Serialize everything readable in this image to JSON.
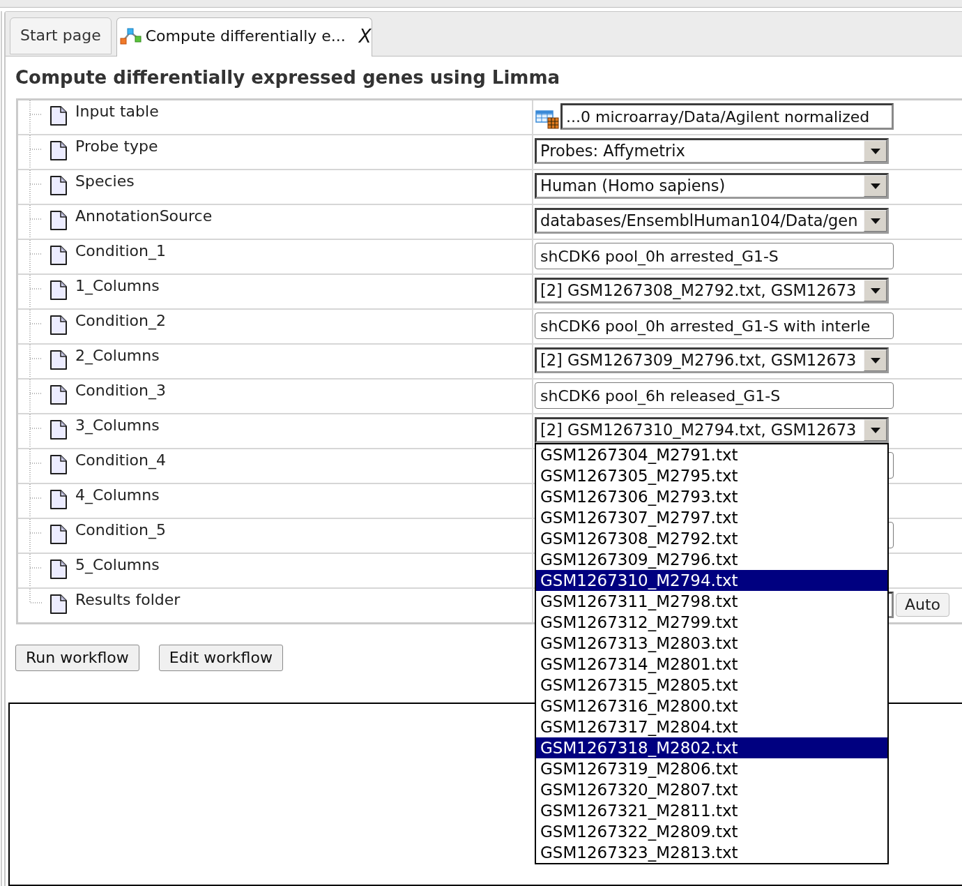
{
  "tabs": [
    {
      "label": "Start page",
      "selected": false,
      "kind": "page"
    },
    {
      "label": "Compute differentially e...",
      "selected": true,
      "kind": "workflow",
      "close": "X"
    }
  ],
  "title": "Compute differentially expressed genes using Limma",
  "parameters": [
    {
      "label": "Input table",
      "control": {
        "kind": "path",
        "value": "...0 microarray/Data/Agilent normalized"
      }
    },
    {
      "label": "Probe type",
      "control": {
        "kind": "select",
        "value": "Probes: Affymetrix",
        "expanded": false
      }
    },
    {
      "label": "Species",
      "control": {
        "kind": "select",
        "value": "Human (Homo sapiens)",
        "expanded": false
      }
    },
    {
      "label": "AnnotationSource",
      "control": {
        "kind": "select",
        "value": "databases/EnsemblHuman104/Data/gen",
        "expanded": false
      }
    },
    {
      "label": "Condition_1",
      "control": {
        "kind": "text",
        "value": "shCDK6 pool_0h arrested_G1-S"
      }
    },
    {
      "label": "1_Columns",
      "control": {
        "kind": "select",
        "value": "[2] GSM1267308_M2792.txt, GSM12673",
        "expanded": false
      }
    },
    {
      "label": "Condition_2",
      "control": {
        "kind": "text",
        "value": "shCDK6 pool_0h arrested_G1-S with interle"
      }
    },
    {
      "label": "2_Columns",
      "control": {
        "kind": "select",
        "value": "[2] GSM1267309_M2796.txt, GSM12673",
        "expanded": false
      }
    },
    {
      "label": "Condition_3",
      "control": {
        "kind": "text",
        "value": "shCDK6 pool_6h released_G1-S"
      }
    },
    {
      "label": "3_Columns",
      "control": {
        "kind": "select",
        "value": "[2] GSM1267310_M2794.txt, GSM12673",
        "expanded": true,
        "options": [
          {
            "label": "GSM1267304_M2791.txt",
            "selected": false
          },
          {
            "label": "GSM1267305_M2795.txt",
            "selected": false
          },
          {
            "label": "GSM1267306_M2793.txt",
            "selected": false
          },
          {
            "label": "GSM1267307_M2797.txt",
            "selected": false
          },
          {
            "label": "GSM1267308_M2792.txt",
            "selected": false
          },
          {
            "label": "GSM1267309_M2796.txt",
            "selected": false
          },
          {
            "label": "GSM1267310_M2794.txt",
            "selected": true
          },
          {
            "label": "GSM1267311_M2798.txt",
            "selected": false
          },
          {
            "label": "GSM1267312_M2799.txt",
            "selected": false
          },
          {
            "label": "GSM1267313_M2803.txt",
            "selected": false
          },
          {
            "label": "GSM1267314_M2801.txt",
            "selected": false
          },
          {
            "label": "GSM1267315_M2805.txt",
            "selected": false
          },
          {
            "label": "GSM1267316_M2800.txt",
            "selected": false
          },
          {
            "label": "GSM1267317_M2804.txt",
            "selected": false
          },
          {
            "label": "GSM1267318_M2802.txt",
            "selected": true
          },
          {
            "label": "GSM1267319_M2806.txt",
            "selected": false
          },
          {
            "label": "GSM1267320_M2807.txt",
            "selected": false
          },
          {
            "label": "GSM1267321_M2811.txt",
            "selected": false
          },
          {
            "label": "GSM1267322_M2809.txt",
            "selected": false
          },
          {
            "label": "GSM1267323_M2813.txt",
            "selected": false
          }
        ]
      }
    },
    {
      "label": "Condition_4",
      "control": {
        "kind": "text"
      }
    },
    {
      "label": "4_Columns"
    },
    {
      "label": "Condition_5",
      "control": {
        "kind": "text"
      }
    },
    {
      "label": "5_Columns"
    },
    {
      "label": "Results folder",
      "control": {
        "kind": "folder",
        "button": "Auto"
      }
    }
  ],
  "buttons": [
    "Run workflow",
    "Edit workflow"
  ]
}
